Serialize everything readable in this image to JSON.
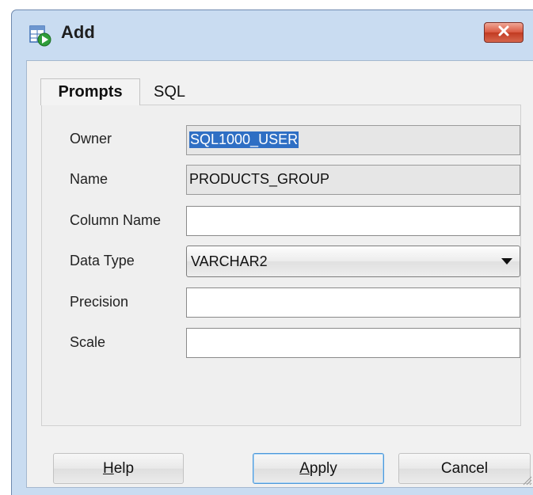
{
  "window": {
    "title": "Add",
    "app_icon": "add-column-icon",
    "close_icon": "close-icon"
  },
  "tabs": [
    {
      "label": "Prompts",
      "active": true
    },
    {
      "label": "SQL",
      "active": false
    }
  ],
  "fields": {
    "owner": {
      "label": "Owner",
      "value": "SQL1000_USER",
      "readonly": true,
      "selected": true
    },
    "name": {
      "label": "Name",
      "value": "PRODUCTS_GROUP",
      "readonly": true
    },
    "column_name": {
      "label": "Column Name",
      "value": ""
    },
    "data_type": {
      "label": "Data Type",
      "value": "VARCHAR2"
    },
    "precision": {
      "label": "Precision",
      "value": ""
    },
    "scale": {
      "label": "Scale",
      "value": ""
    }
  },
  "buttons": {
    "help": {
      "mnemonic": "H",
      "rest": "elp"
    },
    "apply": {
      "mnemonic": "A",
      "rest": "pply"
    },
    "cancel": {
      "label": "Cancel"
    }
  },
  "colors": {
    "frame": "#c9dcf1",
    "selection": "#2f6fc4",
    "close_button": "#c23b22"
  }
}
